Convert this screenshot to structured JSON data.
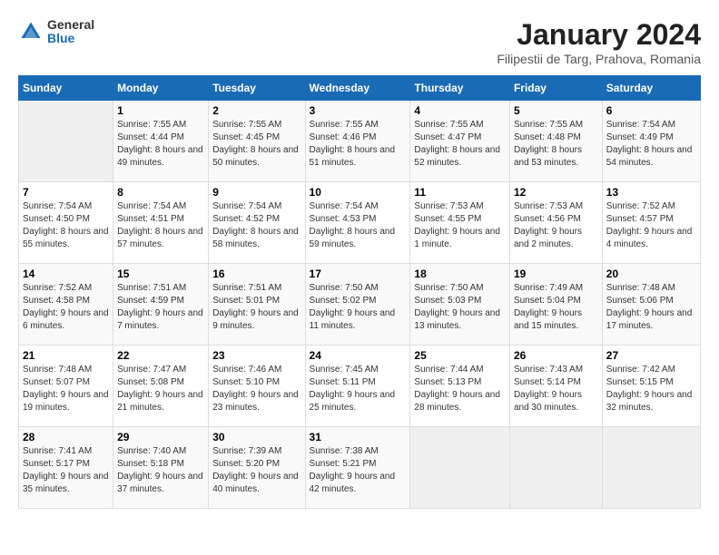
{
  "header": {
    "logo_general": "General",
    "logo_blue": "Blue",
    "month_title": "January 2024",
    "location": "Filipestii de Targ, Prahova, Romania"
  },
  "days_of_week": [
    "Sunday",
    "Monday",
    "Tuesday",
    "Wednesday",
    "Thursday",
    "Friday",
    "Saturday"
  ],
  "weeks": [
    [
      {
        "day": "",
        "sunrise": "",
        "sunset": "",
        "daylight": "",
        "empty": true
      },
      {
        "day": "1",
        "sunrise": "Sunrise: 7:55 AM",
        "sunset": "Sunset: 4:44 PM",
        "daylight": "Daylight: 8 hours and 49 minutes."
      },
      {
        "day": "2",
        "sunrise": "Sunrise: 7:55 AM",
        "sunset": "Sunset: 4:45 PM",
        "daylight": "Daylight: 8 hours and 50 minutes."
      },
      {
        "day": "3",
        "sunrise": "Sunrise: 7:55 AM",
        "sunset": "Sunset: 4:46 PM",
        "daylight": "Daylight: 8 hours and 51 minutes."
      },
      {
        "day": "4",
        "sunrise": "Sunrise: 7:55 AM",
        "sunset": "Sunset: 4:47 PM",
        "daylight": "Daylight: 8 hours and 52 minutes."
      },
      {
        "day": "5",
        "sunrise": "Sunrise: 7:55 AM",
        "sunset": "Sunset: 4:48 PM",
        "daylight": "Daylight: 8 hours and 53 minutes."
      },
      {
        "day": "6",
        "sunrise": "Sunrise: 7:54 AM",
        "sunset": "Sunset: 4:49 PM",
        "daylight": "Daylight: 8 hours and 54 minutes."
      }
    ],
    [
      {
        "day": "7",
        "sunrise": "Sunrise: 7:54 AM",
        "sunset": "Sunset: 4:50 PM",
        "daylight": "Daylight: 8 hours and 55 minutes."
      },
      {
        "day": "8",
        "sunrise": "Sunrise: 7:54 AM",
        "sunset": "Sunset: 4:51 PM",
        "daylight": "Daylight: 8 hours and 57 minutes."
      },
      {
        "day": "9",
        "sunrise": "Sunrise: 7:54 AM",
        "sunset": "Sunset: 4:52 PM",
        "daylight": "Daylight: 8 hours and 58 minutes."
      },
      {
        "day": "10",
        "sunrise": "Sunrise: 7:54 AM",
        "sunset": "Sunset: 4:53 PM",
        "daylight": "Daylight: 8 hours and 59 minutes."
      },
      {
        "day": "11",
        "sunrise": "Sunrise: 7:53 AM",
        "sunset": "Sunset: 4:55 PM",
        "daylight": "Daylight: 9 hours and 1 minute."
      },
      {
        "day": "12",
        "sunrise": "Sunrise: 7:53 AM",
        "sunset": "Sunset: 4:56 PM",
        "daylight": "Daylight: 9 hours and 2 minutes."
      },
      {
        "day": "13",
        "sunrise": "Sunrise: 7:52 AM",
        "sunset": "Sunset: 4:57 PM",
        "daylight": "Daylight: 9 hours and 4 minutes."
      }
    ],
    [
      {
        "day": "14",
        "sunrise": "Sunrise: 7:52 AM",
        "sunset": "Sunset: 4:58 PM",
        "daylight": "Daylight: 9 hours and 6 minutes."
      },
      {
        "day": "15",
        "sunrise": "Sunrise: 7:51 AM",
        "sunset": "Sunset: 4:59 PM",
        "daylight": "Daylight: 9 hours and 7 minutes."
      },
      {
        "day": "16",
        "sunrise": "Sunrise: 7:51 AM",
        "sunset": "Sunset: 5:01 PM",
        "daylight": "Daylight: 9 hours and 9 minutes."
      },
      {
        "day": "17",
        "sunrise": "Sunrise: 7:50 AM",
        "sunset": "Sunset: 5:02 PM",
        "daylight": "Daylight: 9 hours and 11 minutes."
      },
      {
        "day": "18",
        "sunrise": "Sunrise: 7:50 AM",
        "sunset": "Sunset: 5:03 PM",
        "daylight": "Daylight: 9 hours and 13 minutes."
      },
      {
        "day": "19",
        "sunrise": "Sunrise: 7:49 AM",
        "sunset": "Sunset: 5:04 PM",
        "daylight": "Daylight: 9 hours and 15 minutes."
      },
      {
        "day": "20",
        "sunrise": "Sunrise: 7:48 AM",
        "sunset": "Sunset: 5:06 PM",
        "daylight": "Daylight: 9 hours and 17 minutes."
      }
    ],
    [
      {
        "day": "21",
        "sunrise": "Sunrise: 7:48 AM",
        "sunset": "Sunset: 5:07 PM",
        "daylight": "Daylight: 9 hours and 19 minutes."
      },
      {
        "day": "22",
        "sunrise": "Sunrise: 7:47 AM",
        "sunset": "Sunset: 5:08 PM",
        "daylight": "Daylight: 9 hours and 21 minutes."
      },
      {
        "day": "23",
        "sunrise": "Sunrise: 7:46 AM",
        "sunset": "Sunset: 5:10 PM",
        "daylight": "Daylight: 9 hours and 23 minutes."
      },
      {
        "day": "24",
        "sunrise": "Sunrise: 7:45 AM",
        "sunset": "Sunset: 5:11 PM",
        "daylight": "Daylight: 9 hours and 25 minutes."
      },
      {
        "day": "25",
        "sunrise": "Sunrise: 7:44 AM",
        "sunset": "Sunset: 5:13 PM",
        "daylight": "Daylight: 9 hours and 28 minutes."
      },
      {
        "day": "26",
        "sunrise": "Sunrise: 7:43 AM",
        "sunset": "Sunset: 5:14 PM",
        "daylight": "Daylight: 9 hours and 30 minutes."
      },
      {
        "day": "27",
        "sunrise": "Sunrise: 7:42 AM",
        "sunset": "Sunset: 5:15 PM",
        "daylight": "Daylight: 9 hours and 32 minutes."
      }
    ],
    [
      {
        "day": "28",
        "sunrise": "Sunrise: 7:41 AM",
        "sunset": "Sunset: 5:17 PM",
        "daylight": "Daylight: 9 hours and 35 minutes."
      },
      {
        "day": "29",
        "sunrise": "Sunrise: 7:40 AM",
        "sunset": "Sunset: 5:18 PM",
        "daylight": "Daylight: 9 hours and 37 minutes."
      },
      {
        "day": "30",
        "sunrise": "Sunrise: 7:39 AM",
        "sunset": "Sunset: 5:20 PM",
        "daylight": "Daylight: 9 hours and 40 minutes."
      },
      {
        "day": "31",
        "sunrise": "Sunrise: 7:38 AM",
        "sunset": "Sunset: 5:21 PM",
        "daylight": "Daylight: 9 hours and 42 minutes."
      },
      {
        "day": "",
        "sunrise": "",
        "sunset": "",
        "daylight": "",
        "empty": true
      },
      {
        "day": "",
        "sunrise": "",
        "sunset": "",
        "daylight": "",
        "empty": true
      },
      {
        "day": "",
        "sunrise": "",
        "sunset": "",
        "daylight": "",
        "empty": true
      }
    ]
  ]
}
